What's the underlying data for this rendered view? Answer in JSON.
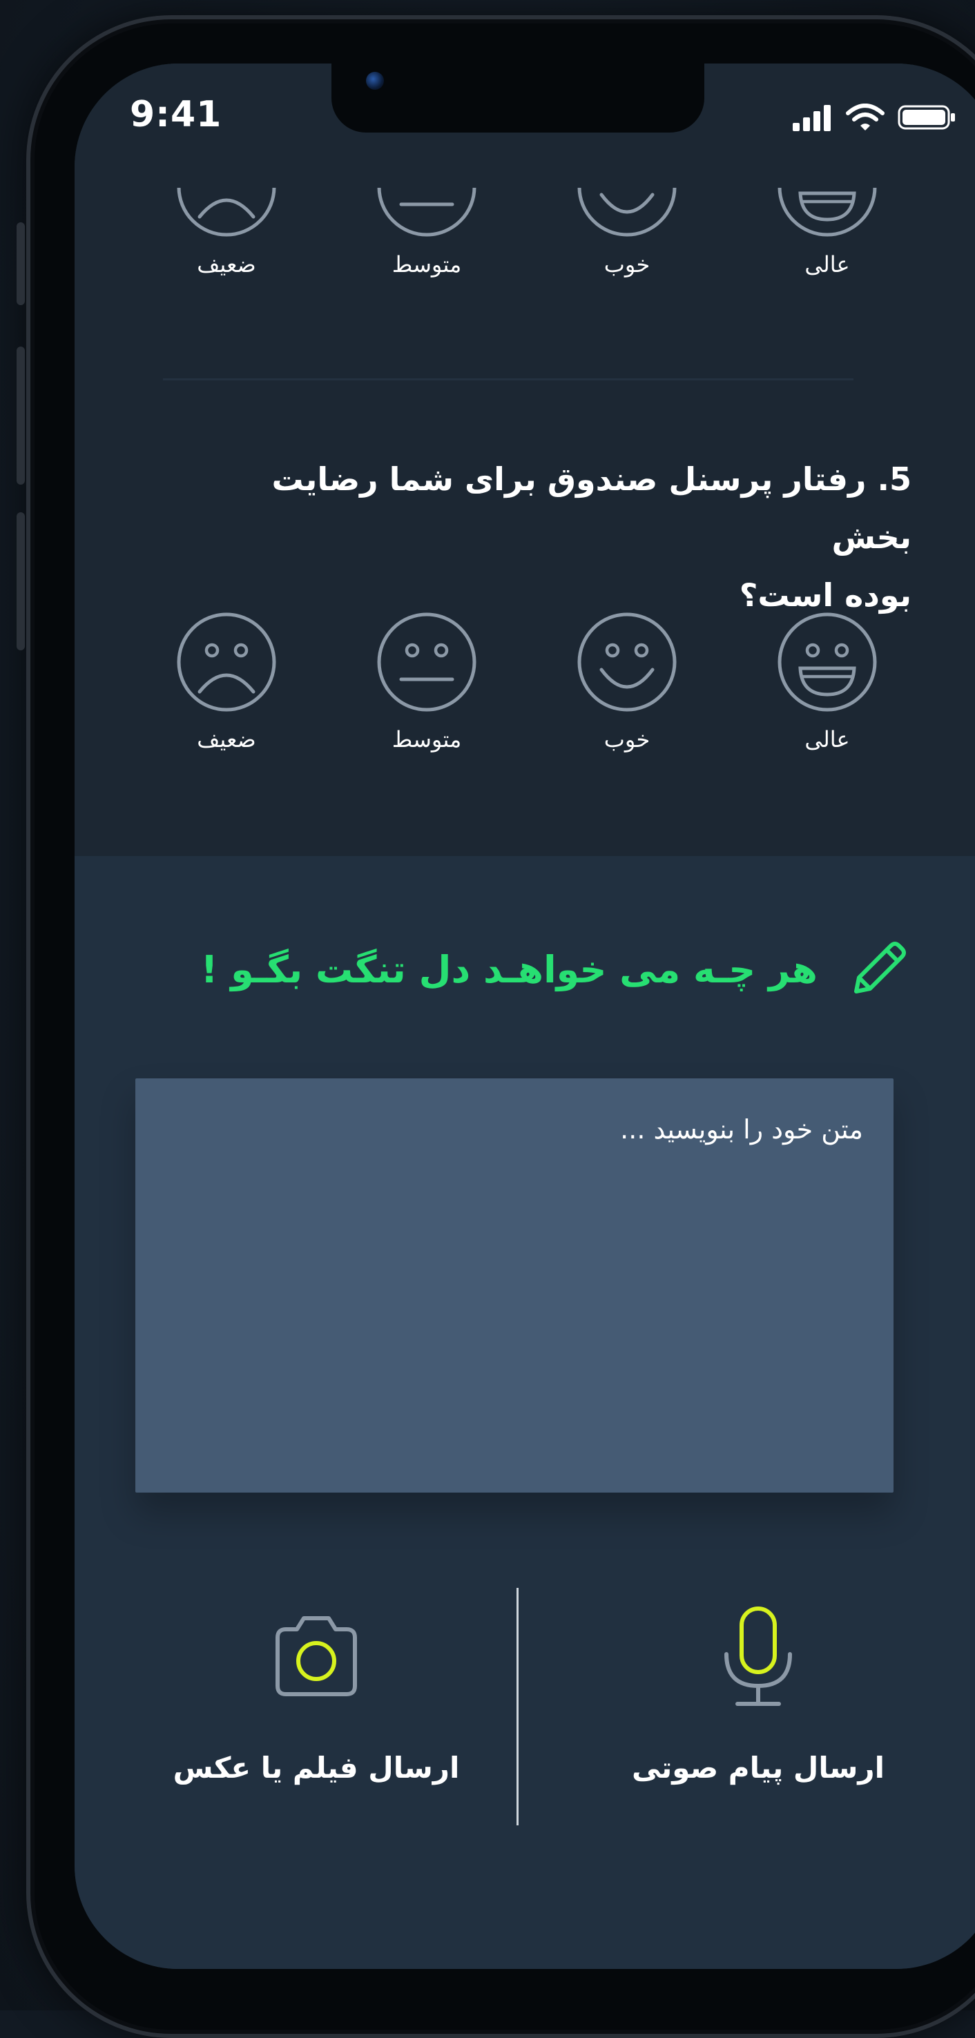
{
  "status_bar": {
    "time": "9:41"
  },
  "previous_question": {
    "options": [
      {
        "label": "عالی",
        "icon": "laughing-face-icon"
      },
      {
        "label": "خوب",
        "icon": "smiling-face-icon"
      },
      {
        "label": "متوسط",
        "icon": "neutral-face-icon"
      },
      {
        "label": "ضعیف",
        "icon": "sad-face-icon"
      }
    ]
  },
  "question5": {
    "line1": "5. رفتار پرسنل صندوق برای شما رضایت بخش",
    "line2": "بوده است؟",
    "options": [
      {
        "label": "عالی",
        "icon": "laughing-face-icon"
      },
      {
        "label": "خوب",
        "icon": "smiling-face-icon"
      },
      {
        "label": "متوسط",
        "icon": "neutral-face-icon"
      },
      {
        "label": "ضعیف",
        "icon": "sad-face-icon"
      }
    ]
  },
  "feedback": {
    "prompt": "هر چـه می خواهـد دل تنگت بگـو !",
    "prompt_icon": "pencil-icon",
    "placeholder": "متن خود را بنویسید ..."
  },
  "actions": {
    "voice_label": "ارسال پیام صوتی",
    "voice_icon": "microphone-icon",
    "media_label": "ارسال فیلم یا عکس",
    "media_icon": "camera-icon"
  },
  "colors": {
    "accent_green": "#27df72",
    "accent_yellow": "#d7f21e",
    "icon_gray": "#8c99a7",
    "textarea_bg": "#455b74"
  }
}
